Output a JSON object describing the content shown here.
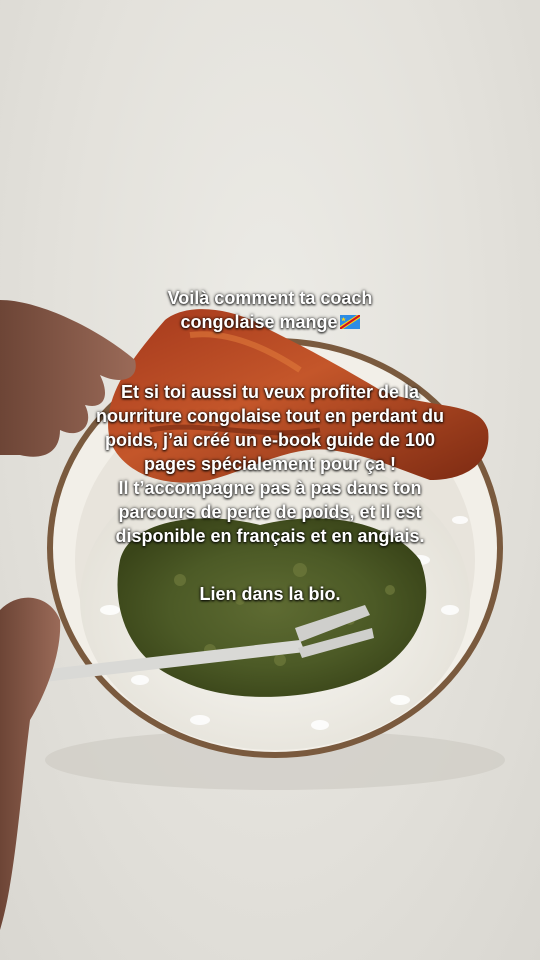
{
  "caption": {
    "title_lines": [
      "Voilà comment ta coach",
      "congolaise mange"
    ],
    "title_emoji": "flag-drc-icon",
    "body_lines": [
      "Et si toi aussi tu veux profiter de la",
      "nourriture congolaise tout en perdant du",
      "poids, j’ai créé un e-book guide de 100",
      "pages spécialement pour ça !",
      "Il t’accompagne pas à pas dans ton",
      "parcours de perte de poids, et il est",
      "disponible en français et en anglais."
    ],
    "cta": "Lien dans la bio."
  },
  "colors": {
    "text": "#ffffff",
    "background": "#e6e4de",
    "flag_blue": "#2d8de6",
    "flag_red": "#ce1021",
    "flag_yellow": "#f7d618"
  }
}
